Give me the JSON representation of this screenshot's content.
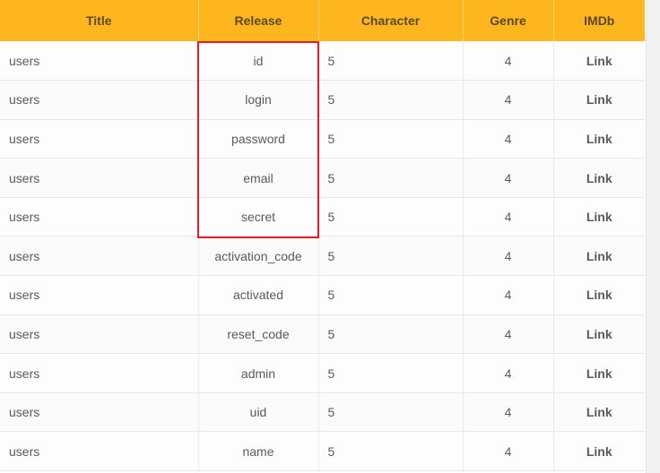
{
  "table": {
    "headers": [
      "Title",
      "Release",
      "Character",
      "Genre",
      "IMDb"
    ],
    "rows": [
      {
        "title": "users",
        "release": "id",
        "character": "5",
        "genre": "4",
        "imdb": "Link"
      },
      {
        "title": "users",
        "release": "login",
        "character": "5",
        "genre": "4",
        "imdb": "Link"
      },
      {
        "title": "users",
        "release": "password",
        "character": "5",
        "genre": "4",
        "imdb": "Link"
      },
      {
        "title": "users",
        "release": "email",
        "character": "5",
        "genre": "4",
        "imdb": "Link"
      },
      {
        "title": "users",
        "release": "secret",
        "character": "5",
        "genre": "4",
        "imdb": "Link"
      },
      {
        "title": "users",
        "release": "activation_code",
        "character": "5",
        "genre": "4",
        "imdb": "Link"
      },
      {
        "title": "users",
        "release": "activated",
        "character": "5",
        "genre": "4",
        "imdb": "Link"
      },
      {
        "title": "users",
        "release": "reset_code",
        "character": "5",
        "genre": "4",
        "imdb": "Link"
      },
      {
        "title": "users",
        "release": "admin",
        "character": "5",
        "genre": "4",
        "imdb": "Link"
      },
      {
        "title": "users",
        "release": "uid",
        "character": "5",
        "genre": "4",
        "imdb": "Link"
      },
      {
        "title": "users",
        "release": "name",
        "character": "5",
        "genre": "4",
        "imdb": "Link"
      }
    ]
  },
  "colors": {
    "header_background": "#fdb61e",
    "highlight_border": "#e21b24"
  }
}
